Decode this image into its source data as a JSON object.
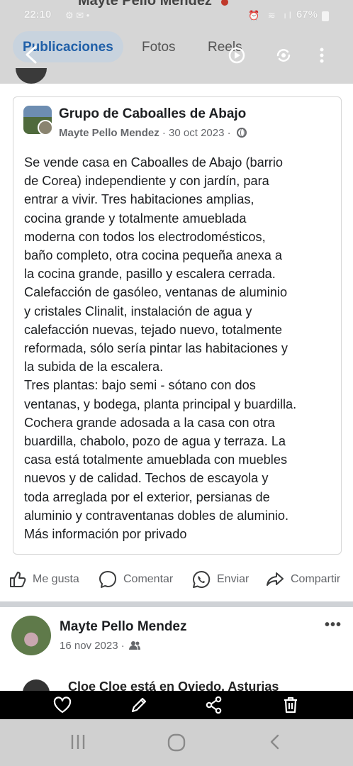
{
  "status_bar": {
    "time": "22:10",
    "battery": "67%"
  },
  "header": {
    "ghost_title": "Mayte Pello Mendez",
    "tabs": [
      {
        "label": "Publicaciones",
        "active": true
      },
      {
        "label": "Fotos",
        "active": false
      },
      {
        "label": "Reels",
        "active": false
      }
    ]
  },
  "post": {
    "group_name": "Grupo de Caboalles de Abajo",
    "author": "Mayte Pello Mendez",
    "date": "30 oct 2023",
    "body": "Se vende casa en Caboalles de Abajo (barrio\nde Corea) independiente y con jardín, para\nentrar a vivir. Tres habitaciones amplias,\ncocina grande y totalmente amueblada\nmoderna con todos los electrodomésticos,\nbaño completo, otra cocina pequeña anexa a\nla cocina grande, pasillo y escalera cerrada.\nCalefacción de gasóleo, ventanas de aluminio\ny cristales Clinalit, instalación de agua y\ncalefacción nuevas, tejado nuevo, totalmente\nreformada, sólo sería pintar las habitaciones y\nla subida de la escalera.\nTres plantas: bajo semi - sótano con dos\nventanas, y bodega, planta principal y buardilla.\nCochera grande adosada a la casa con otra\nbuardilla, chabolo, pozo de agua y terraza. La\ncasa está totalmente amueblada con muebles\nnuevos y de calidad. Techos de escayola y\ntoda arreglada por el exterior, persianas de\naluminio y contraventanas dobles de aluminio.\nMás información por privado"
  },
  "actions": {
    "like": "Me gusta",
    "comment": "Comentar",
    "send": "Enviar",
    "share": "Compartir"
  },
  "post2": {
    "author": "Mayte Pello Mendez",
    "date": "16 nov 2023",
    "more": "•••"
  },
  "post3_peek": {
    "text": "Cloe Cloe está en Oviedo, Asturias"
  },
  "colors": {
    "accent": "#1f5fa8",
    "secondary_text": "#65676b",
    "toolbar": "#000000",
    "navbar": "#d0d0d0"
  }
}
